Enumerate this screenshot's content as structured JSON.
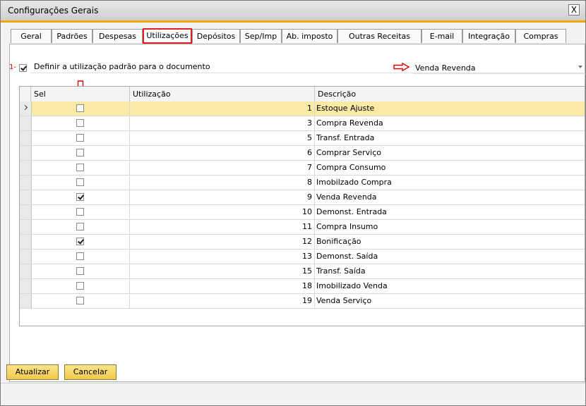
{
  "window": {
    "title": "Configurações Gerais",
    "close_label": "X"
  },
  "tabs": [
    {
      "label": "Geral",
      "active": false
    },
    {
      "label": "Padrões",
      "active": false
    },
    {
      "label": "Despesas",
      "active": false
    },
    {
      "label": "Utilizações",
      "active": true
    },
    {
      "label": "Depósitos",
      "active": false
    },
    {
      "label": "Sep/Imp",
      "active": false
    },
    {
      "label": "Ab. imposto",
      "active": false
    },
    {
      "label": "Outras Receitas",
      "active": false
    },
    {
      "label": "E-mail",
      "active": false
    },
    {
      "label": "Integração",
      "active": false
    },
    {
      "label": "Compras",
      "active": false
    }
  ],
  "default_usage": {
    "marker": "1-",
    "checked": true,
    "label": "Definir a utilização padrão para o documento",
    "dropdown_value": "Venda Revenda"
  },
  "grid": {
    "headers": {
      "sel": "Sel",
      "utilizacao": "Utilização",
      "descricao": "Descrição"
    },
    "rows": [
      {
        "num": "1",
        "desc": "Estoque Ajuste",
        "checked": false
      },
      {
        "num": "3",
        "desc": "Compra Revenda",
        "checked": false
      },
      {
        "num": "5",
        "desc": "Transf. Entrada",
        "checked": false
      },
      {
        "num": "6",
        "desc": "Comprar Serviço",
        "checked": false
      },
      {
        "num": "7",
        "desc": "Compra Consumo",
        "checked": false
      },
      {
        "num": "8",
        "desc": "Imobilzado Compra",
        "checked": false
      },
      {
        "num": "9",
        "desc": "Venda Revenda",
        "checked": true
      },
      {
        "num": "10",
        "desc": "Demonst. Entrada",
        "checked": false
      },
      {
        "num": "11",
        "desc": "Compra Insumo",
        "checked": false
      },
      {
        "num": "12",
        "desc": "Bonificação",
        "checked": true
      },
      {
        "num": "13",
        "desc": "Demonst. Saída",
        "checked": false
      },
      {
        "num": "15",
        "desc": "Transf. Saída",
        "checked": false
      },
      {
        "num": "18",
        "desc": "Imobilizado Venda",
        "checked": false
      },
      {
        "num": "19",
        "desc": "Venda Serviço",
        "checked": false
      }
    ],
    "selected_row": 0
  },
  "buttons": {
    "update": "Atualizar",
    "cancel": "Cancelar"
  },
  "colors": {
    "accent": "#f0a800",
    "highlight": "#e02020",
    "selected_row": "#fbe9a6",
    "button": "#f1c94a"
  }
}
